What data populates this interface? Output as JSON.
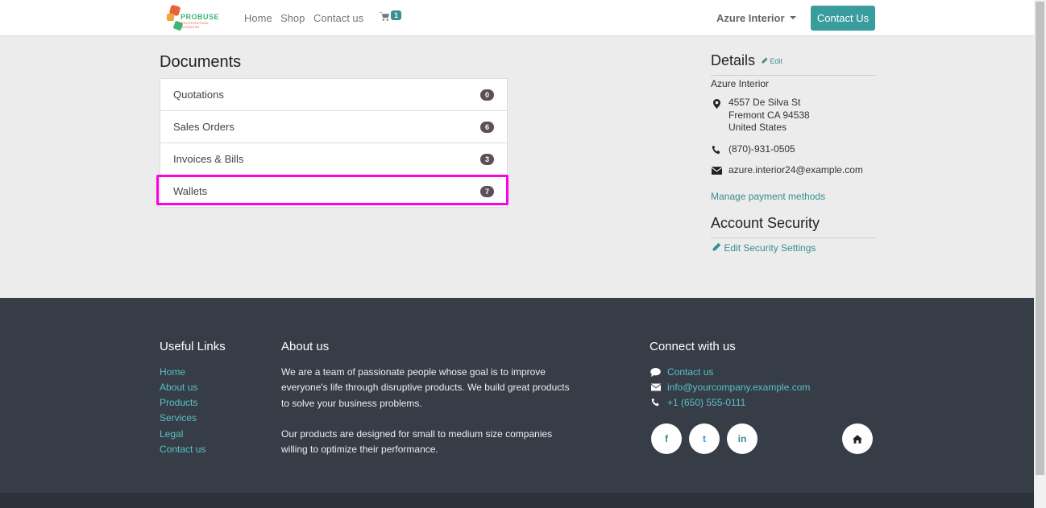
{
  "header": {
    "logo_text": "PROBUSE",
    "logo_sub": "PROFESSIONAL BUSINESS",
    "nav": [
      "Home",
      "Shop",
      "Contact us"
    ],
    "cart_count": "1",
    "user": "Azure Interior",
    "contact_button": "Contact Us"
  },
  "documents": {
    "title": "Documents",
    "items": [
      {
        "label": "Quotations",
        "count": "0"
      },
      {
        "label": "Sales Orders",
        "count": "6"
      },
      {
        "label": "Invoices & Bills",
        "count": "3"
      },
      {
        "label": "Wallets",
        "count": "7"
      }
    ],
    "highlighted_item": "Wallets"
  },
  "details": {
    "title": "Details",
    "edit_label": "Edit",
    "name": "Azure Interior",
    "address": [
      "4557 De Silva St",
      "Fremont CA 94538",
      "United States"
    ],
    "phone": "(870)-931-0505",
    "email": "azure.interior24@example.com",
    "manage_payment": "Manage payment methods"
  },
  "security": {
    "title": "Account Security",
    "edit_label": "Edit Security Settings"
  },
  "footer": {
    "useful_links_title": "Useful Links",
    "useful_links": [
      "Home",
      "About us",
      "Products",
      "Services",
      "Legal",
      "Contact us"
    ],
    "about_title": "About us",
    "about_p1": "We are a team of passionate people whose goal is to improve everyone's life through disruptive products. We build great products to solve your business problems.",
    "about_p2": "Our products are designed for small to medium size companies willing to optimize their performance.",
    "connect_title": "Connect with us",
    "contact_link": "Contact us",
    "email": "info@yourcompany.example.com",
    "phone": "+1 (650) 555-0111",
    "social": [
      "f",
      "t",
      "in"
    ]
  },
  "colors": {
    "accent": "#3a9d9d",
    "link": "#3a8e8e",
    "highlight": "#ff00e6",
    "footer_bg": "#363d47",
    "badge": "#5e4e59"
  }
}
